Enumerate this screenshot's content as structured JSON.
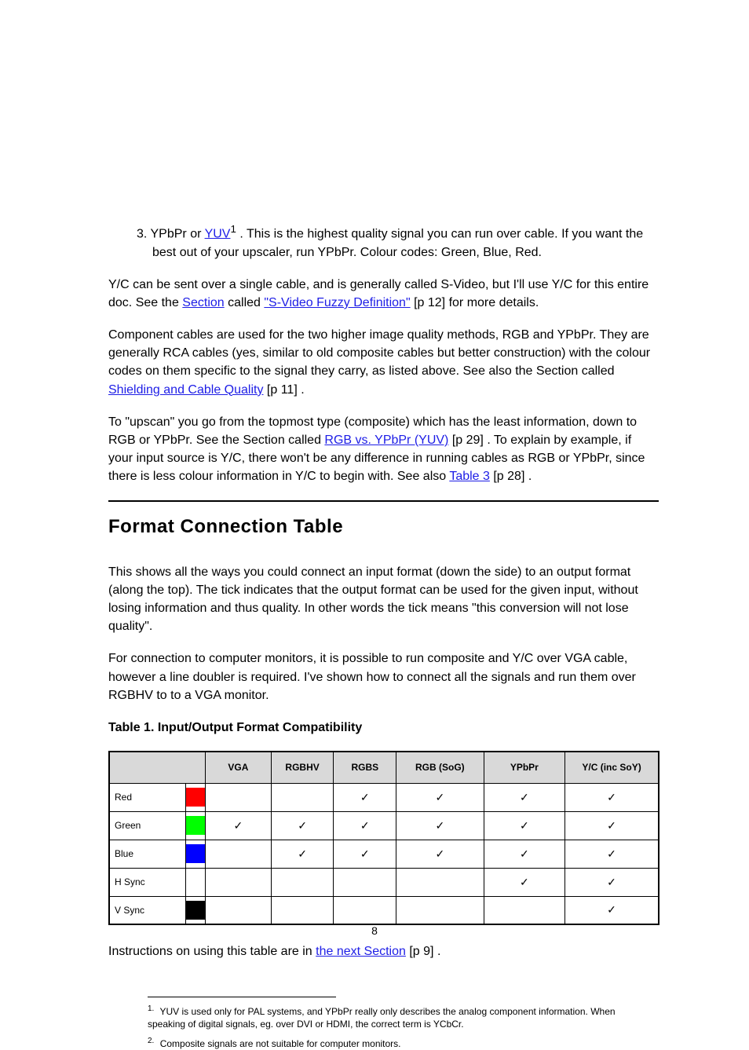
{
  "intro": {
    "bullet3": {
      "lead": "3. YPbPr or",
      "yuv": "YUV",
      "sup1": "1",
      "rest": ". This is the highest quality signal you can run over cable. If you want the best out of your upscaler, run YPbPr. Colour codes: Green, Blue, Red."
    },
    "yc_para": {
      "part1": "Y/C can be sent over a single cable, and is generally called S-Video, but I'll use Y/C for this entire doc. See the ",
      "link1_text": "Section",
      "link1_after": " called ",
      "link1_quoted_text": "\"S-Video Fuzzy Definition\"",
      "link1_page": " [p 12]",
      "after": " for more details."
    },
    "component_para": {
      "part1": "Component cables are used for the two higher image quality methods, RGB and YPbPr. They are generally RCA cables (yes, similar to old composite cables but better construction) with the colour codes on them specific to the signal they carry, as listed above. See also ",
      "link_text": "the Section called ",
      "link_quoted": "Shielding and Cable Quality",
      "link_page": " [p 11]",
      "after": " ."
    },
    "upscan_para": {
      "part1": "To \"upscan\" you go from the topmost type (composite) which has the least information, down to RGB or YPbPr. See ",
      "link_text": "the Section called ",
      "link_quoted": "RGB vs. YPbPr (YUV)",
      "link_page": " [p 29]",
      "after1": " . To explain by example, if your input source is Y/C, there won't be any difference in running cables as RGB or YPbPr, since there is less colour information in Y/C to begin with. See also ",
      "link2_text": "Table 3",
      "link2_page": " [p 28]",
      "after2": " ."
    }
  },
  "section_title": "Format Connection Table",
  "table_intro": {
    "p1": "This shows all the ways you could connect an input format (down the side) to an output format (along the top). The tick indicates that the output format can be used for the given input, without losing information and thus quality. In other words the tick means \"this conversion will not lose quality\".",
    "p2": "For connection to computer monitors, it is possible to run composite and Y/C over VGA cable, however a line doubler is required. I've shown how to connect all the signals and run them over RGBHV to to a VGA monitor.",
    "caption": "Table 1. Input/Output Format Compatibility"
  },
  "table": {
    "headers": [
      "",
      "VGA",
      "RGBHV",
      "RGBS",
      "RGB (SoG)",
      "YPbPr",
      "Y/C (inc SoY)"
    ],
    "rows": [
      {
        "label": "Red",
        "swatch": "red",
        "cells": [
          "",
          "",
          "✓",
          "✓",
          "✓",
          "✓"
        ]
      },
      {
        "label": "Green",
        "swatch": "green",
        "cells": [
          "✓",
          "✓",
          "✓",
          "✓",
          "✓",
          "✓"
        ]
      },
      {
        "label": "Blue",
        "swatch": "blue",
        "cells": [
          "",
          "✓",
          "✓",
          "✓",
          "✓",
          "✓"
        ]
      },
      {
        "label": "H Sync",
        "swatch": "",
        "cells": [
          "",
          "",
          "",
          "",
          "✓",
          "✓"
        ]
      },
      {
        "label": "V Sync",
        "swatch": "black",
        "cells": [
          "",
          "",
          "",
          "",
          "",
          "✓"
        ]
      }
    ]
  },
  "table_footer": {
    "text": "Instructions on using this table are in ",
    "link_text": "the next Section",
    "page_ref": " [p 9]",
    "after": " ."
  },
  "footnote": {
    "num": "1.",
    "text": "YUV is used only for PAL systems, and YPbPr really only describes the analog component information. When speaking of digital signals, eg. over DVI or HDMI, the correct term is YCbCr.",
    "num2": "2.",
    "text2": "Composite signals are not suitable for computer monitors."
  },
  "page_number": "8"
}
